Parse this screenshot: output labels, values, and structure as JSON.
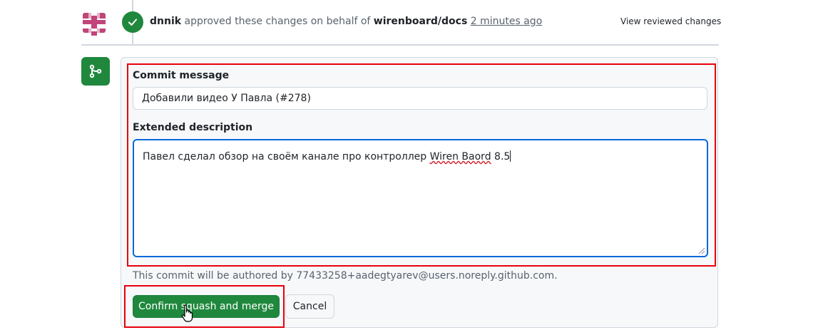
{
  "review": {
    "avatar_icon": "identicon-avatar",
    "status_icon": "check-icon",
    "reviewer": "dnnik",
    "action_text": "approved these changes on behalf of",
    "org": "wirenboard/docs",
    "time": "2 minutes ago",
    "view_reviewed": "View reviewed changes"
  },
  "merge": {
    "icon": "git-merge-icon",
    "commit_message_label": "Commit message",
    "commit_message_value": "Добавили видео У Павла (#278)",
    "extended_description_label": "Extended description",
    "extended_description_before": "Павел сделал обзор на своём канале про контроллер ",
    "extended_description_misspelled": "Wiren Baord",
    "extended_description_after": " 8.5",
    "author_note": "This commit will be authored by 77433258+aadegtyarev@users.noreply.github.com.",
    "confirm_label": "Confirm squash and merge",
    "cancel_label": "Cancel"
  },
  "colors": {
    "success_green": "#1f883d",
    "focus_blue": "#0969da",
    "highlight_red": "#e8000b"
  }
}
